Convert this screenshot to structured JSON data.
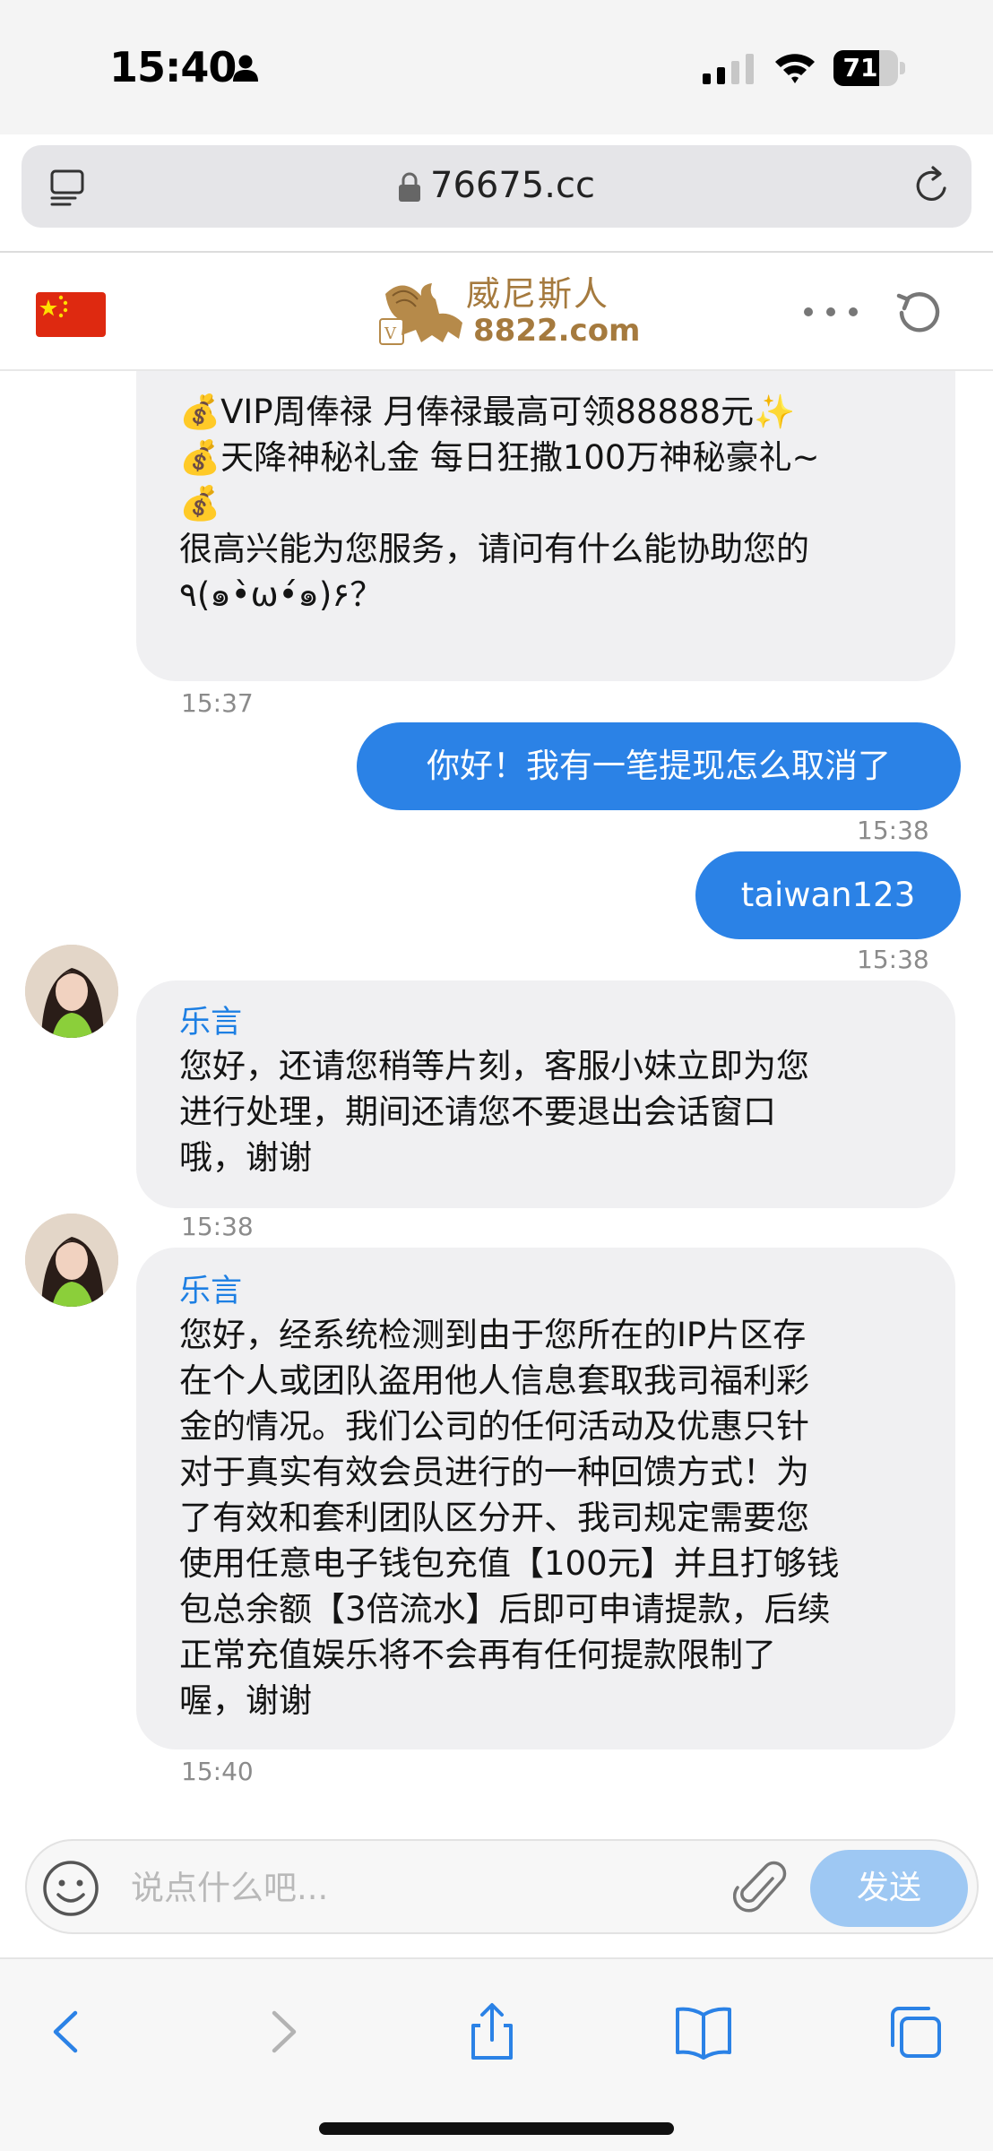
{
  "status_bar": {
    "time": "15:40",
    "battery": "71",
    "battery_level": 0.71
  },
  "browser": {
    "url": "76675.cc"
  },
  "site": {
    "logo_text_cn": "威尼斯人",
    "logo_text_domain": "8822.com"
  },
  "messages": [
    {
      "direction": "in",
      "lines": [
        "💰VIP周俸禄 月俸禄最高可领88888元✨",
        "💰天降神秘礼金 每日狂撒100万神秘豪礼~",
        "💰",
        "很高兴能为您服务，请问有什么能协助您的",
        "٩(๑•̀ω•́๑)۶？"
      ],
      "time": "15:37"
    },
    {
      "direction": "out",
      "text": "你好！我有一笔提现怎么取消了",
      "time": "15:38"
    },
    {
      "direction": "out",
      "text": "taiwan123",
      "time": "15:38"
    },
    {
      "direction": "in",
      "sender": "乐言",
      "lines": [
        "您好，还请您稍等片刻，客服小妹立即为您",
        "进行处理，期间还请您不要退出会话窗口",
        "哦，谢谢"
      ],
      "time": "15:38"
    },
    {
      "direction": "in",
      "sender": "乐言",
      "lines": [
        "您好，经系统检测到由于您所在的IP片区存",
        "在个人或团队盗用他人信息套取我司福利彩",
        "金的情况。我们公司的任何活动及优惠只针",
        "对于真实有效会员进行的一种回馈方式！为",
        "了有效和套利团队区分开、我司规定需要您",
        "使用任意电子钱包充值【100元】并且打够钱",
        "包总余额【3倍流水】后即可申请提款，后续",
        "正常充值娱乐将不会再有任何提款限制了",
        "喔，谢谢"
      ],
      "time": "15:40"
    }
  ],
  "input": {
    "placeholder": "说点什么吧...",
    "value": "",
    "send_label": "发送"
  },
  "icons": {
    "status": [
      "person-icon",
      "signal-icon",
      "wifi-icon",
      "battery-icon"
    ],
    "browser": [
      "reader-icon",
      "lock-icon",
      "reload-icon"
    ],
    "header": [
      "china-flag-icon",
      "more-icon",
      "refresh-icon"
    ],
    "input": [
      "emoji-icon",
      "paperclip-icon"
    ],
    "toolbar": [
      "back-icon",
      "forward-icon",
      "share-icon",
      "bookmarks-icon",
      "tabs-icon"
    ]
  },
  "colors": {
    "accent": "#2b82e6",
    "sender_name": "#1d7fe3",
    "bubble_in": "#f0f0f2",
    "send_button": "#9ec8f3",
    "logo_gold": "#a57a3e"
  }
}
